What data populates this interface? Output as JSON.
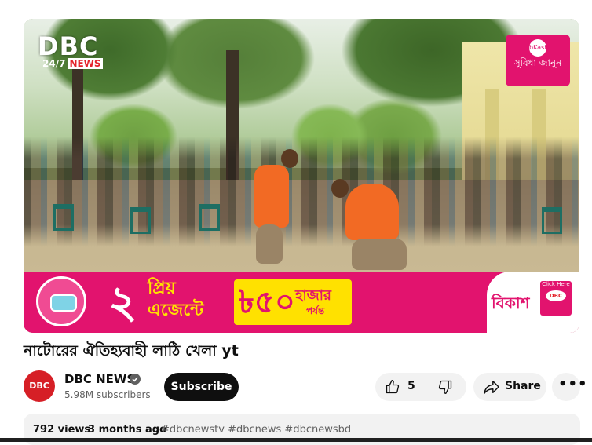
{
  "video": {
    "overlay_logo_main": "DBC",
    "overlay_logo_sub": "24/7",
    "overlay_logo_news": "NEWS",
    "corner_ad_text": "সুবিধা জানুন",
    "banner": {
      "number": "২",
      "text_line1": "প্রিয়",
      "text_line2": "এজেন্টে",
      "amount": "৳৫০",
      "amount_unit": "হাজার",
      "amount_suffix": "পর্যন্ত",
      "brand": "বিকাশ",
      "click_here": "Click Here",
      "click_logo": "DBC"
    }
  },
  "title": "নাটোরের ঐতিহ্যবাহী লাঠি খেলা yt",
  "channel": {
    "avatar_text": "DBC",
    "name": "DBC NEWS",
    "subscribers": "5.98M subscribers",
    "subscribe_label": "Subscribe"
  },
  "actions": {
    "like_count": "5",
    "share_label": "Share",
    "more_label": "•••"
  },
  "description": {
    "views": "792 views",
    "age": "3 months ago",
    "hashtags": "#dbcnewstv #dbcnews #dbcnewsbd"
  },
  "colors": {
    "bkash_pink": "#e2136e",
    "banner_yellow": "#ffe100",
    "subscribe_bg": "#0f0f0f",
    "pill_bg": "#f2f2f2"
  }
}
